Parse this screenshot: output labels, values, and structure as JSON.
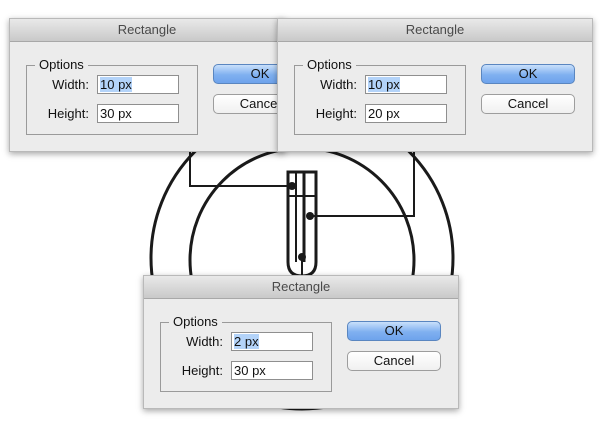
{
  "dialogs": [
    {
      "title": "Rectangle",
      "options_label": "Options",
      "width_label": "Width:",
      "width_value": "10 px",
      "height_label": "Height:",
      "height_value": "30 px",
      "ok_label": "OK",
      "cancel_label": "Cancel"
    },
    {
      "title": "Rectangle",
      "options_label": "Options",
      "width_label": "Width:",
      "width_value": "10 px",
      "height_label": "Height:",
      "height_value": "20 px",
      "ok_label": "OK",
      "cancel_label": "Cancel"
    },
    {
      "title": "Rectangle",
      "options_label": "Options",
      "width_label": "Width:",
      "width_value": "2 px",
      "height_label": "Height:",
      "height_value": "30 px",
      "ok_label": "OK",
      "cancel_label": "Cancel"
    }
  ],
  "colors": {
    "ok_button": "#7fb0f0",
    "selection": "#b3d3f9",
    "artwork_stroke": "#1a1a1a"
  }
}
